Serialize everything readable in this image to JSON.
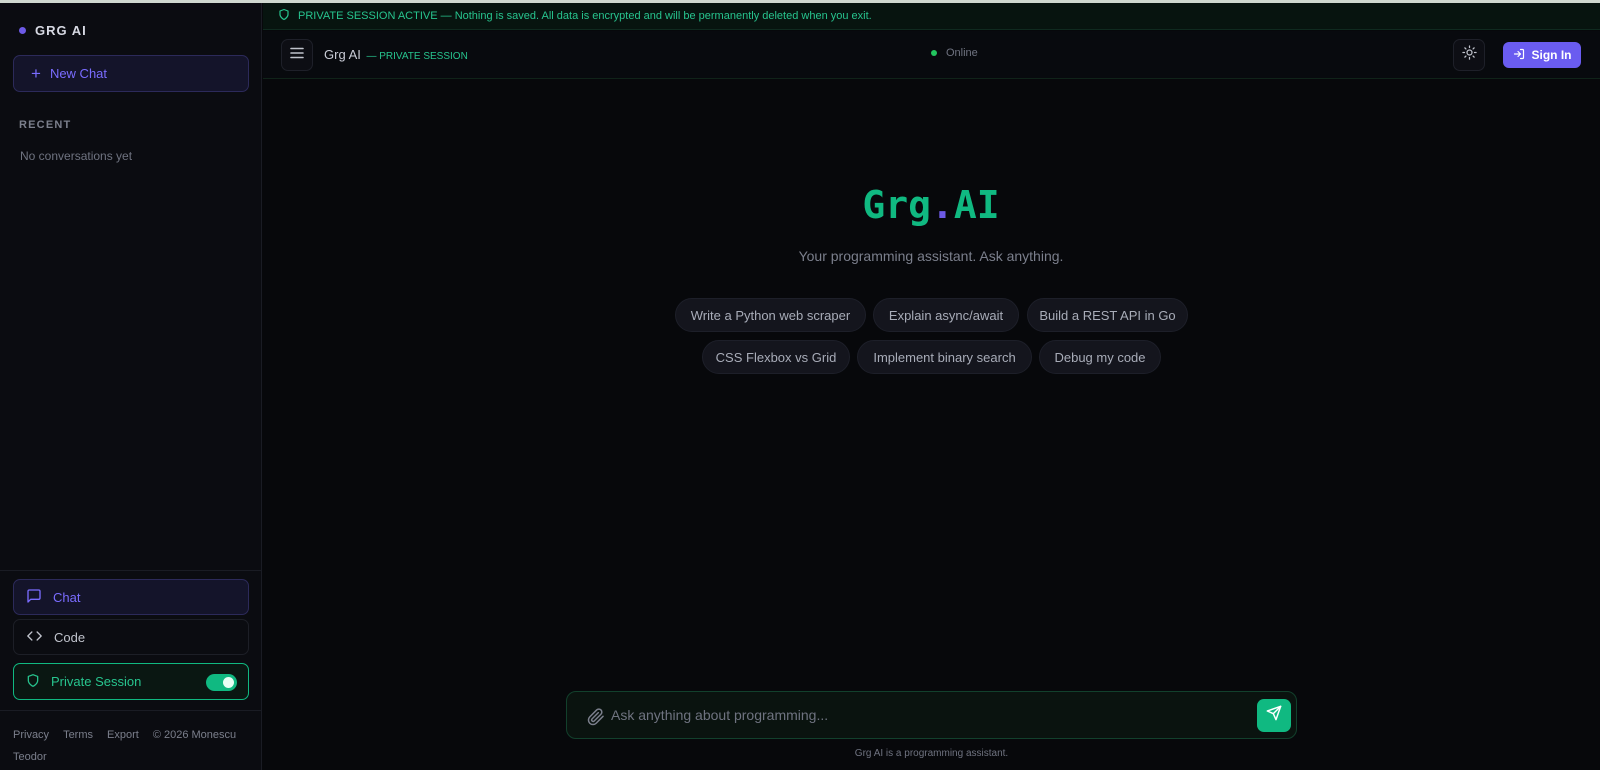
{
  "brand": {
    "name": "GRG AI"
  },
  "sidebar": {
    "new_chat_label": "New Chat",
    "recent_title": "RECENT",
    "recent_empty": "No conversations yet",
    "nav": {
      "chat": "Chat",
      "code": "Code",
      "private_session": "Private Session"
    },
    "private_session_enabled": true,
    "footer": {
      "privacy": "Privacy",
      "terms": "Terms",
      "export": "Export",
      "copyright": "© 2026 Monescu Teodor"
    }
  },
  "banner": {
    "strong": "PRIVATE SESSION ACTIVE",
    "text": " — Nothing is saved. All data is encrypted and will be permanently deleted when you exit."
  },
  "header": {
    "title": "Grg AI",
    "subtitle": "— PRIVATE SESSION",
    "status": "Online",
    "signin_label": "Sign In"
  },
  "hero": {
    "logo_left": "Grg",
    "logo_dot": ".",
    "logo_right": "AI",
    "tagline": "Your programming assistant. Ask anything."
  },
  "suggestions": [
    "Write a Python web scraper",
    "Explain async/await",
    "Build a REST API in Go",
    "CSS Flexbox vs Grid",
    "Implement binary search",
    "Debug my code"
  ],
  "composer": {
    "placeholder": "Ask anything about programming...",
    "value": "",
    "disclaimer": "Grg AI is a programming assistant."
  },
  "colors": {
    "accent_green": "#10b981",
    "accent_purple": "#6a5cf0",
    "background": "#07080b"
  },
  "icons": [
    "plus-icon",
    "chat-bubble-icon",
    "code-icon",
    "shield-icon",
    "menu-icon",
    "sun-icon",
    "sign-in-icon",
    "paperclip-icon",
    "send-icon"
  ]
}
